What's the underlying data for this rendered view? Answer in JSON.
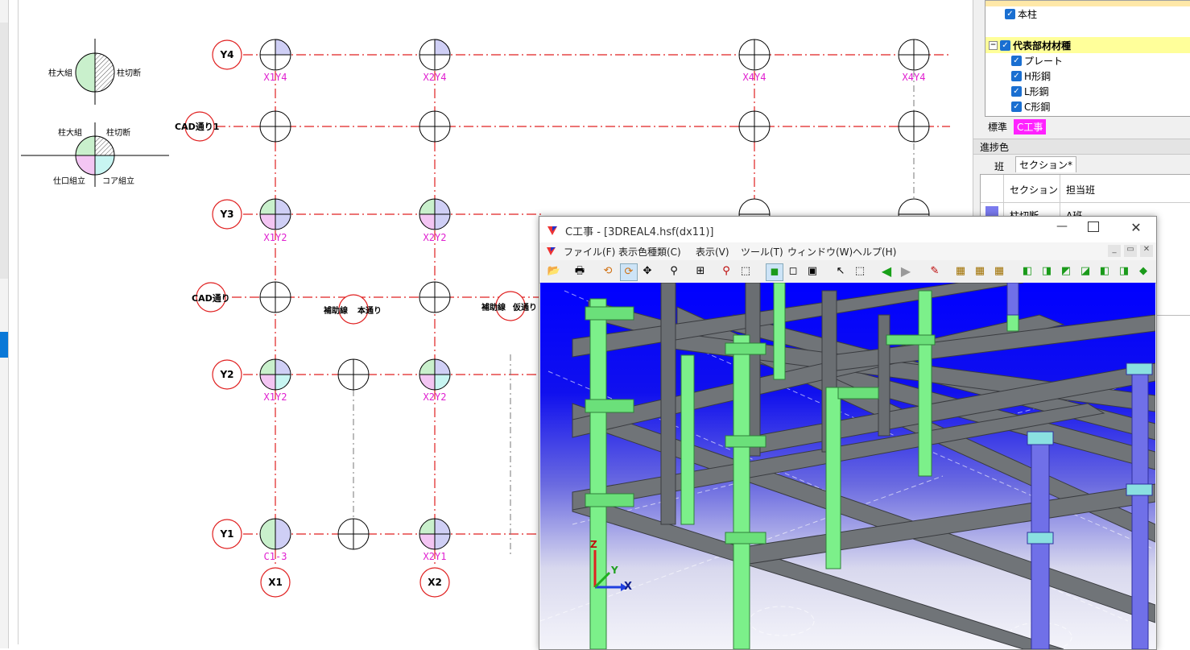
{
  "legend": {
    "a": {
      "left": "柱大組",
      "right": "柱切断"
    },
    "b": {
      "tl": "柱大組",
      "tr": "柱切断",
      "bl": "仕口組立",
      "br": "コア組立"
    }
  },
  "grid": {
    "y4": "Y4",
    "cad1": "CAD通り1",
    "y3": "Y3",
    "cad": "CAD通り",
    "y2": "Y2",
    "y1": "Y1",
    "x1": "X1",
    "x2": "X2",
    "aux1a": "補助線",
    "aux1b": "本通り",
    "aux2a": "補助線",
    "aux2b": "仮通り"
  },
  "labels": {
    "x1y4": "X1Y4",
    "x2y4": "X2Y4",
    "x4y4a": "X4Y4",
    "x4y4b": "X4Y4",
    "x1y2a": "X1Y2",
    "x2y2a": "X2Y2",
    "x1y2b": "X1Y2",
    "x2y2b": "X2Y2",
    "c13": "C1-3",
    "x2y1": "X2Y1"
  },
  "tree": {
    "items": [
      {
        "label": "本柱",
        "checked": true
      },
      {
        "label": "代表部材材種",
        "checked": true
      },
      {
        "label": "プレート",
        "checked": true
      },
      {
        "label": "H形鋼",
        "checked": true
      },
      {
        "label": "L形鋼",
        "checked": true
      },
      {
        "label": "C形鋼",
        "checked": true
      }
    ],
    "tab_std": "標準",
    "tab_c": "C工事"
  },
  "panel": {
    "progress_title": "進捗色",
    "tab_team": "班",
    "tab_section": "セクション*",
    "col_section": "セクション",
    "col_team": "担当班",
    "row1_section": "柱切断",
    "row1_team": "A班"
  },
  "window3d": {
    "title": "C工事 - [3DREAL4.hsf(dx11)]",
    "menu": [
      "ファイル(F)",
      "表示色種類(C)",
      "表示(V)",
      "ツール(T)",
      "ウィンドウ(W)",
      "ヘルプ(H)"
    ],
    "axis_x": "X",
    "axis_y": "Y",
    "axis_z": "Z"
  },
  "colors": {
    "grid_red": "#e02020",
    "label_magenta": "#e020d0",
    "green_member": "#7cf08a",
    "gray_member": "#707478",
    "blue_member": "#7070e8",
    "tab_c_bg": "#ff22ff"
  }
}
